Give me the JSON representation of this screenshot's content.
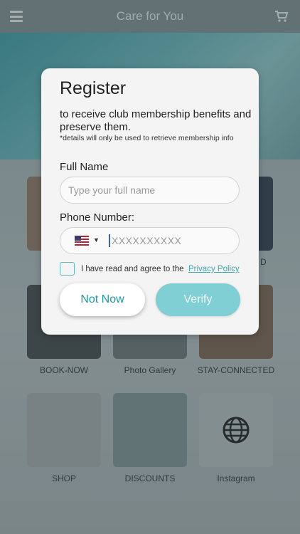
{
  "app": {
    "title": "Care for You",
    "menu_icon": "hamburger-menu-icon",
    "cart_icon": "shopping-cart-icon",
    "tiles": [
      {
        "label": "BOOK-NOW"
      },
      {
        "label": "Photo Gallery"
      },
      {
        "label": "STAY-CONNECTED"
      },
      {
        "label": "SHOP"
      },
      {
        "label": "DISCOUNTS"
      },
      {
        "label": "Instagram",
        "icon": "globe-icon"
      }
    ],
    "partial_label": "D"
  },
  "modal": {
    "title": "Register",
    "subtitle": "to receive club membership benefits and preserve them.",
    "note": "*details will only be used to retrieve membership info",
    "full_name_label": "Full Name",
    "full_name_placeholder": "Type your full name",
    "phone_label": "Phone Number:",
    "phone_placeholder": "XXXXXXXXXX",
    "country_flag": "us-flag-icon",
    "agree_text": "I have read and agree to the",
    "privacy_link": "Privacy Policy",
    "not_now_label": "Not Now",
    "verify_label": "Verify"
  },
  "colors": {
    "accent": "#1e9aa5",
    "verify_bg": "#7fcfd4",
    "link": "#3aa8b2"
  }
}
